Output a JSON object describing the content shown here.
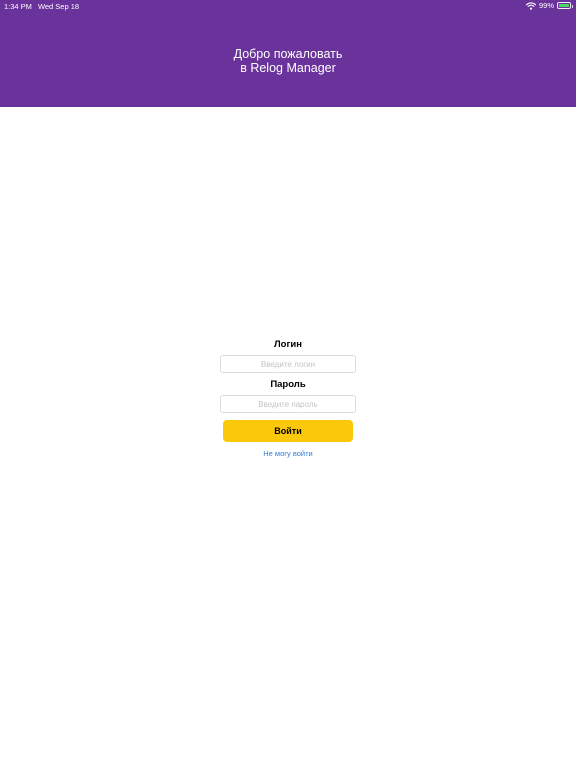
{
  "status_bar": {
    "time": "1:34 PM",
    "date": "Wed Sep 18",
    "battery_percent": "99%",
    "battery_level": 0.99,
    "wifi_icon": "wifi-icon",
    "battery_icon": "battery-icon",
    "battery_color": "#4cd964"
  },
  "header": {
    "line1": "Добро пожаловать",
    "line2": "в Relog Manager",
    "background_color": "#6a339b"
  },
  "login_form": {
    "login_label": "Логин",
    "login_placeholder": "Введите логин",
    "login_value": "",
    "password_label": "Пароль",
    "password_placeholder": "Введите пароль",
    "password_value": "",
    "submit_label": "Войти",
    "submit_color": "#fcc80a",
    "forgot_link": "Не могу войти",
    "link_color": "#2f7bd6"
  }
}
